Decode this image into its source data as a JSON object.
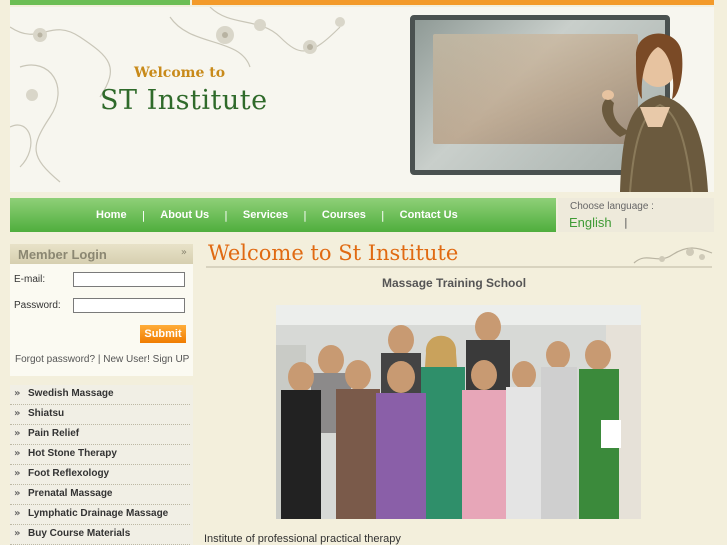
{
  "banner": {
    "welcome_to": "Welcome to",
    "title": "ST  Institute"
  },
  "nav": {
    "items": [
      "Home",
      "About Us",
      "Services",
      "Courses",
      "Contact Us"
    ],
    "separator": "|"
  },
  "language": {
    "label": "Choose language :",
    "current": "English",
    "separator": "|"
  },
  "login": {
    "title": "Member Login",
    "email_label": "E-mail:",
    "email_value": "",
    "password_label": "Password:",
    "password_value": "",
    "submit_label": "Submit",
    "forgot_link": "Forgot password?",
    "link_sep": "|",
    "signup_link": "New User! Sign UP"
  },
  "menu": {
    "items": [
      "Swedish Massage",
      "Shiatsu",
      "Pain Relief",
      "Hot Stone Therapy",
      "Foot Reflexology",
      "Prenatal Massage",
      "Lymphatic Drainage Massage",
      "Buy Course Materials"
    ]
  },
  "main": {
    "title": "Welcome to St  Institute",
    "subtitle": "Massage Training School",
    "caption": "Institute of professional practical therapy"
  },
  "colors": {
    "nav_green": "#4fae3d",
    "accent_orange": "#f39a2a",
    "title_orange": "#e06a12",
    "banner_green": "#2f6a2a"
  },
  "icons": {
    "collapse": "double-chevron-down-icon",
    "menu_bullet": "double-chevron-right-icon"
  }
}
